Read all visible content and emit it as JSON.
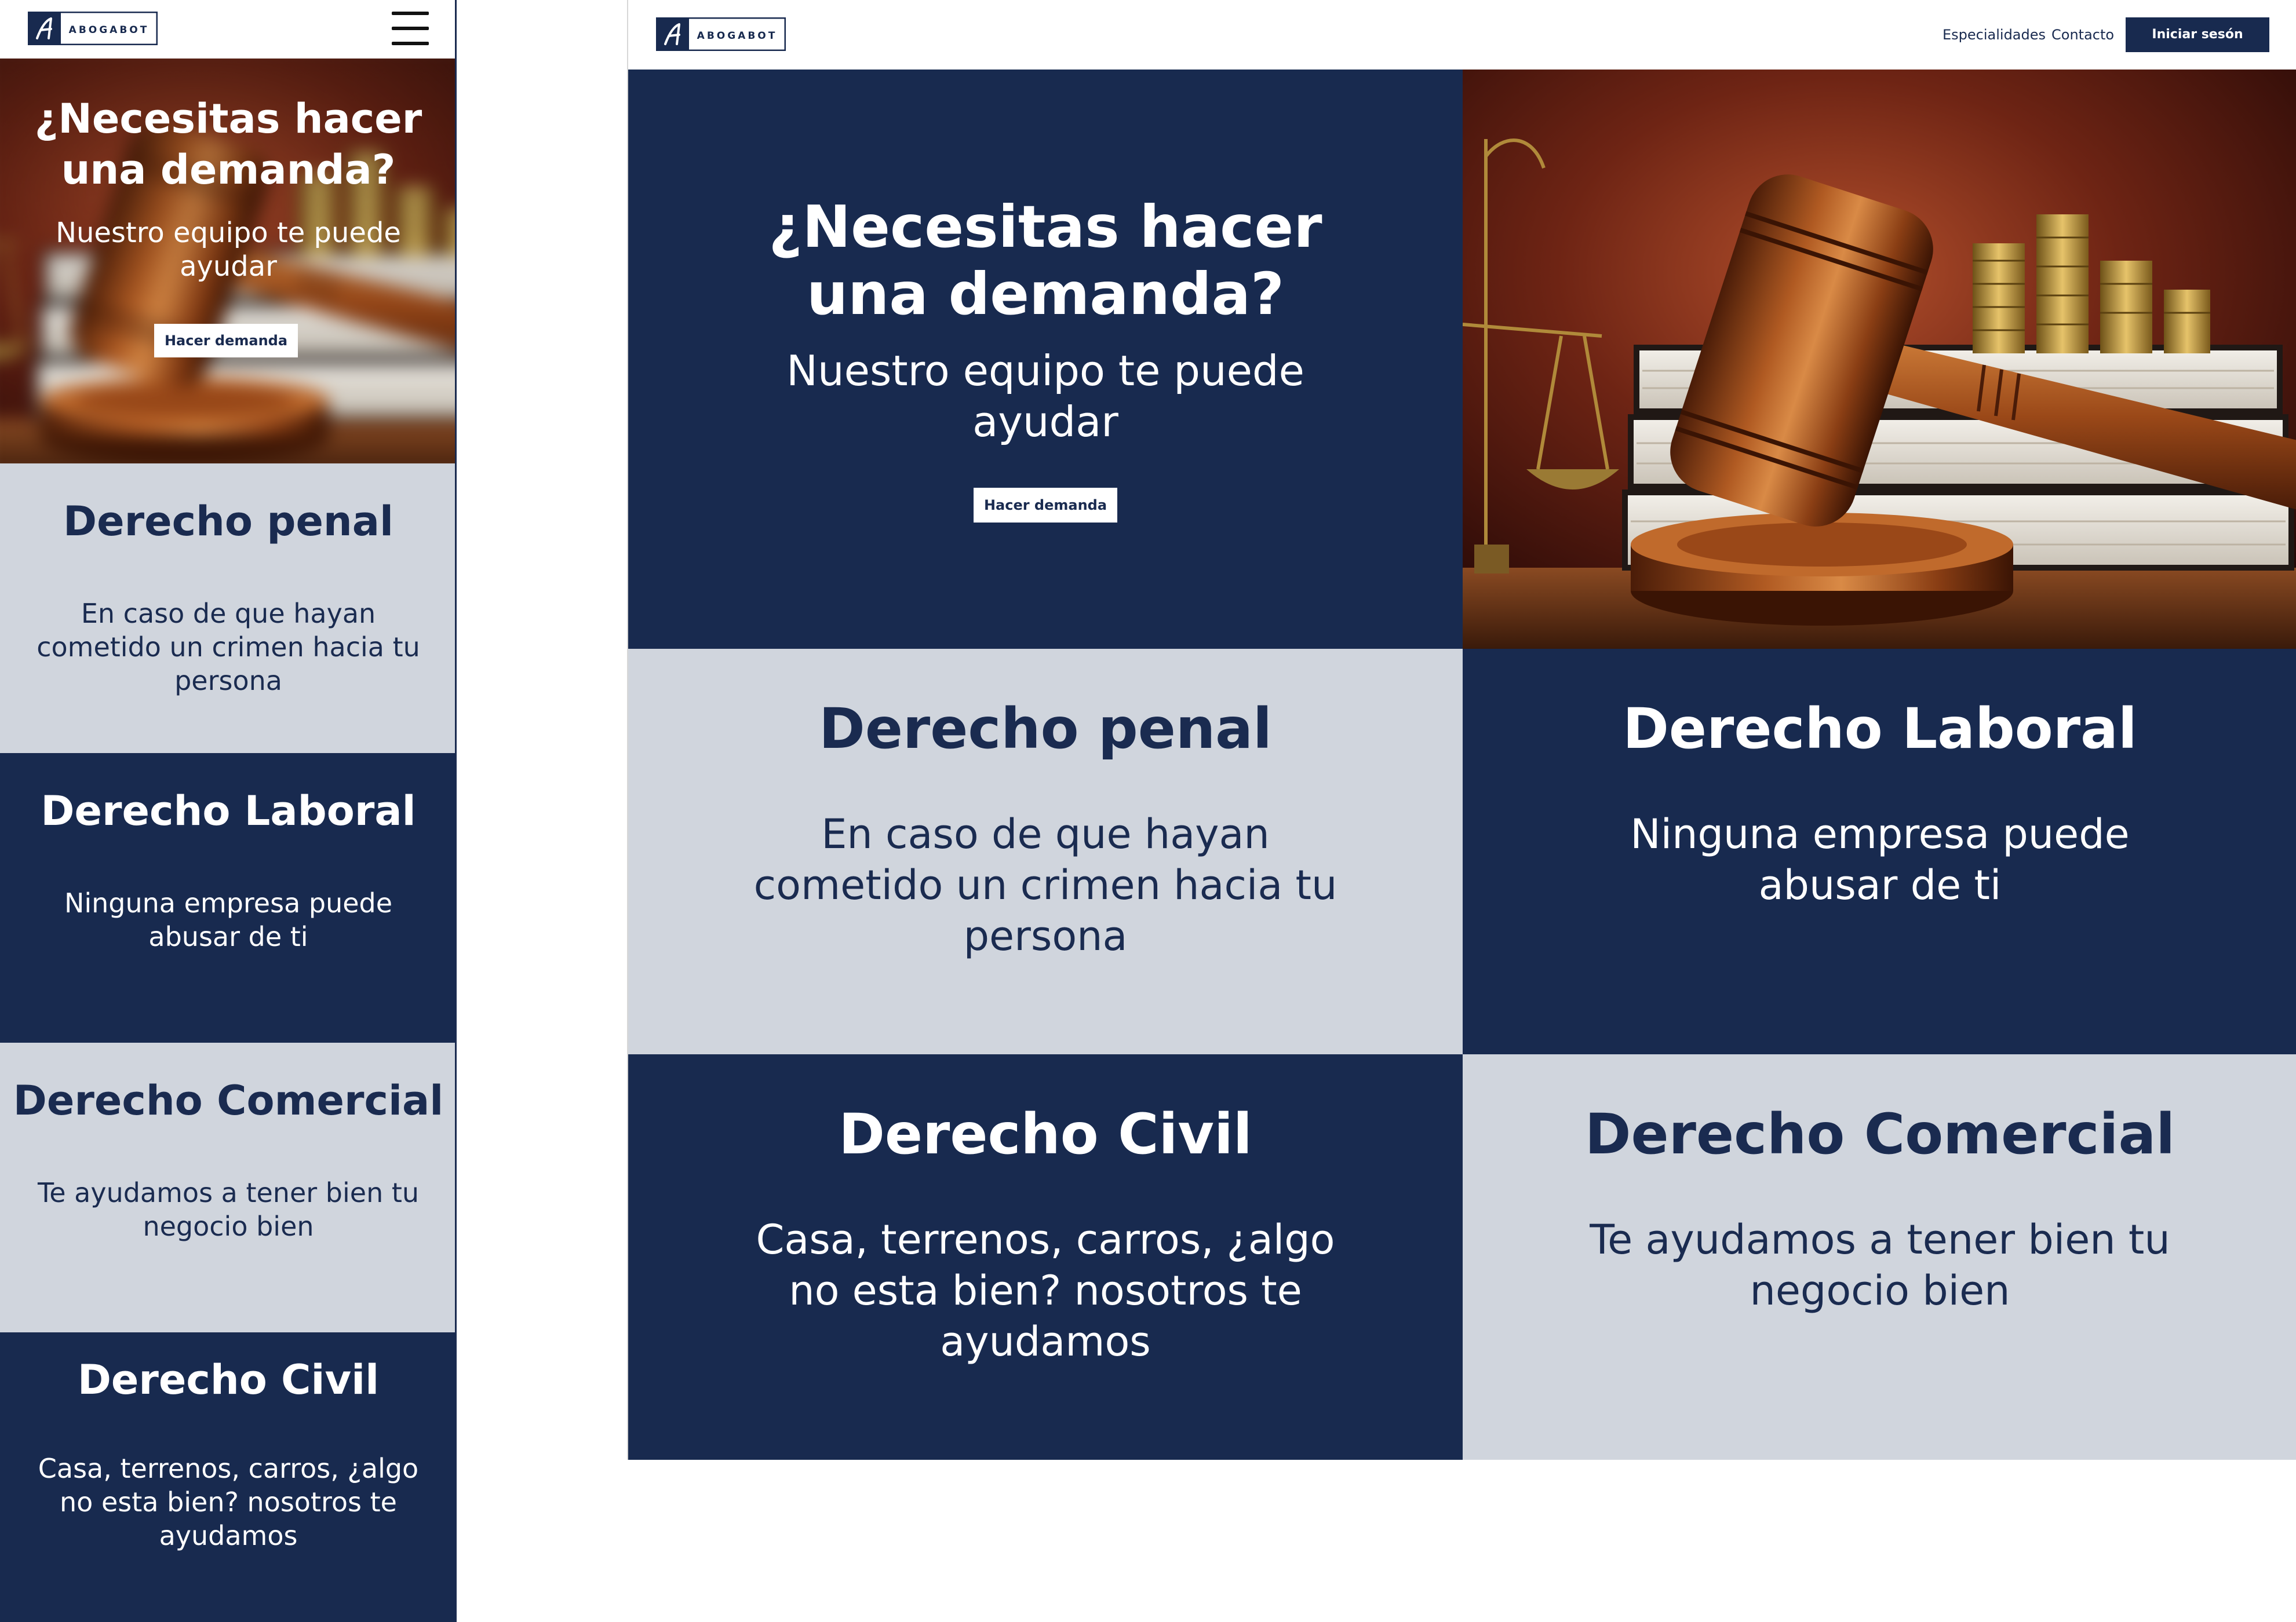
{
  "brand": {
    "name": "ABOGABOT",
    "mark": "A"
  },
  "colors": {
    "navy": "#182a4f",
    "light_gray": "#d0d5dd",
    "white": "#ffffff"
  },
  "nav": {
    "links": [
      "Especialidades",
      "Contacto"
    ],
    "login_label": "Iniciar sesón"
  },
  "hero": {
    "title": "¿Necesitas hacer una demanda?",
    "subtitle": "Nuestro equipo te puede ayudar",
    "button_label": "Hacer demanda",
    "image_subject": "gavel-books-scales-coins"
  },
  "services": [
    {
      "title": "Derecho penal",
      "description": "En caso de que hayan cometido un crimen hacia tu persona"
    },
    {
      "title": "Derecho Laboral",
      "description": "Ninguna empresa puede abusar de ti"
    },
    {
      "title": "Derecho Comercial",
      "description": "Te ayudamos a tener bien tu negocio bien"
    },
    {
      "title": "Derecho Civil",
      "description": "Casa, terrenos, carros, ¿algo no esta bien? nosotros te ayudamos"
    }
  ],
  "icons": {
    "menu": "hamburger-menu-icon"
  }
}
